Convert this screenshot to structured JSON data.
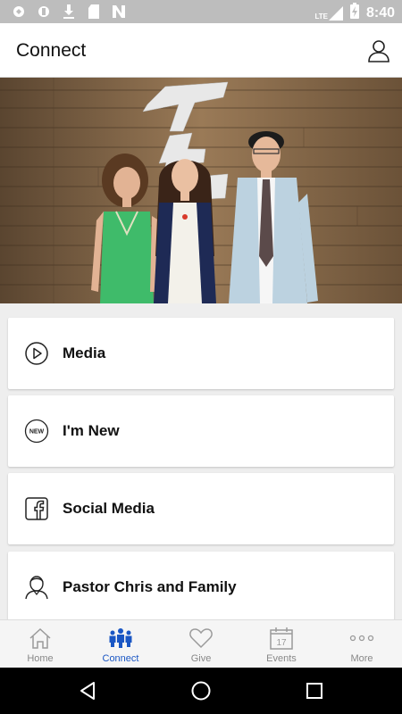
{
  "status_bar": {
    "time": "8:40",
    "network_label": "LTE",
    "battery_icon": "battery-charging-icon",
    "left_icons": [
      "notification-icon",
      "notification-icon",
      "download-icon",
      "sd-card-icon",
      "n-app-icon"
    ]
  },
  "header": {
    "title": "Connect",
    "profile_icon": "person-icon"
  },
  "hero": {
    "image": "three-people-standing-in-front-of-wooden-wall-with-church-logo"
  },
  "menu": {
    "items": [
      {
        "label": "Media",
        "icon": "play-circle-icon"
      },
      {
        "label": "I'm New",
        "icon": "new-badge-icon",
        "badge_text": "NEW"
      },
      {
        "label": "Social Media",
        "icon": "facebook-icon"
      },
      {
        "label": "Pastor Chris and Family",
        "icon": "pastor-avatar-icon"
      }
    ]
  },
  "tabs": [
    {
      "label": "Home",
      "icon": "home-icon"
    },
    {
      "label": "Connect",
      "icon": "people-icon",
      "active": true
    },
    {
      "label": "Give",
      "icon": "heart-icon"
    },
    {
      "label": "Events",
      "icon": "calendar-icon",
      "calendar_day": "17"
    },
    {
      "label": "More",
      "icon": "more-dots-icon"
    }
  ],
  "colors": {
    "accent": "#1a56c4",
    "inactive": "#888888",
    "status_bar": "#bdbdbd",
    "background": "#eeeeee"
  }
}
